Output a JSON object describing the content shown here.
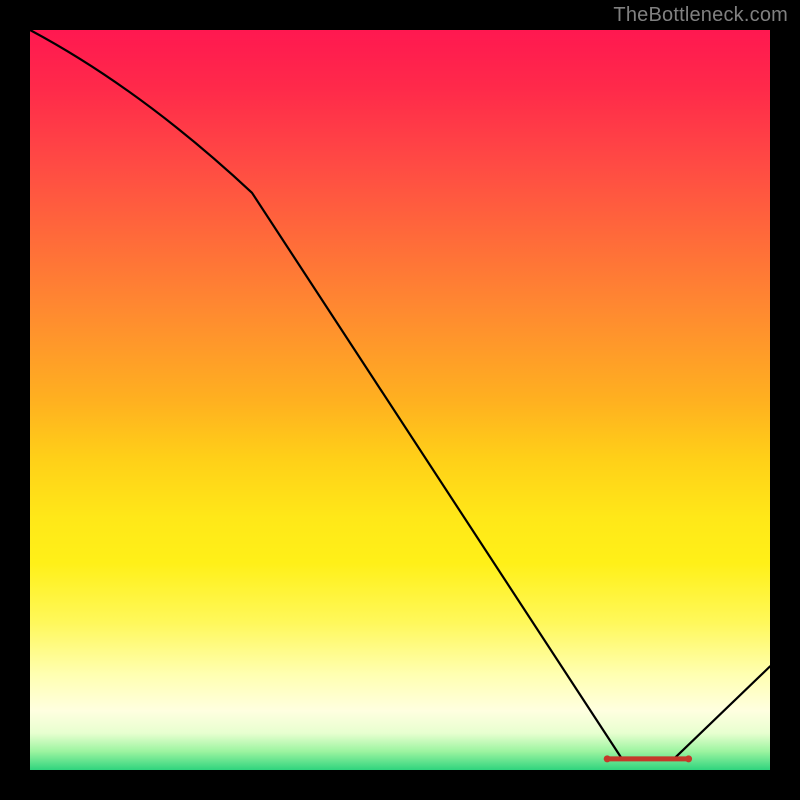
{
  "watermark": "TheBottleneck.com",
  "chart_data": {
    "type": "line",
    "title": "",
    "xlabel": "",
    "ylabel": "",
    "xlim": [
      0,
      100
    ],
    "ylim": [
      0,
      100
    ],
    "series": [
      {
        "name": "curve",
        "x": [
          0,
          30,
          80,
          87,
          100
        ],
        "y": [
          100,
          78,
          1.5,
          1.5,
          14
        ]
      }
    ],
    "flat_segment": {
      "x_start": 78,
      "x_end": 89,
      "y": 1.5
    },
    "gradient_stops": [
      {
        "pos": 0.0,
        "color": "#ff1850"
      },
      {
        "pos": 0.5,
        "color": "#ffb020"
      },
      {
        "pos": 0.8,
        "color": "#fff85a"
      },
      {
        "pos": 0.95,
        "color": "#e8ffd0"
      },
      {
        "pos": 1.0,
        "color": "#2fd47e"
      }
    ]
  }
}
